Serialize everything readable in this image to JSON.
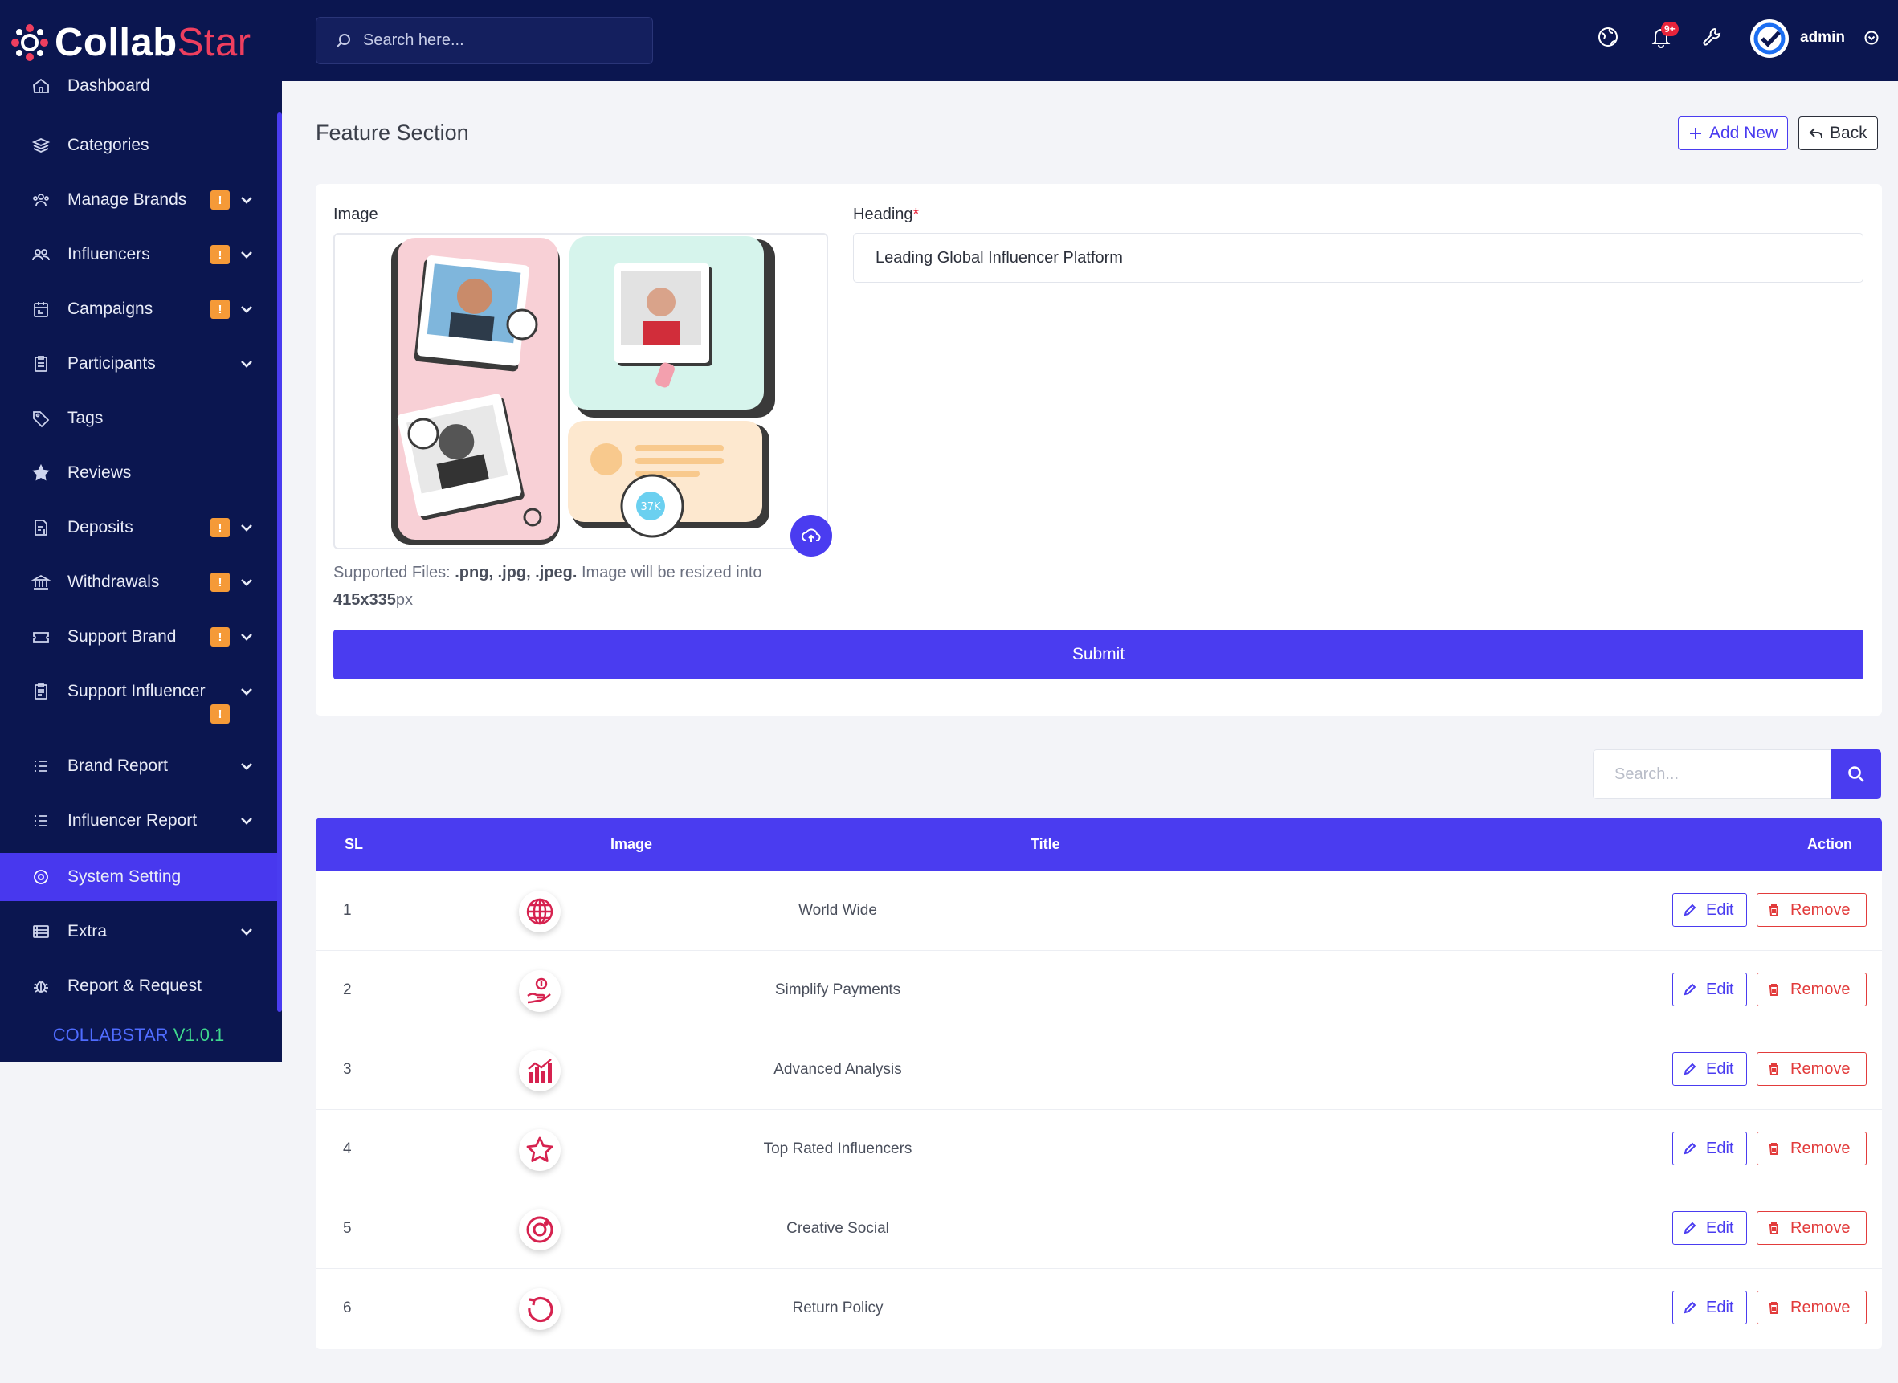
{
  "brand": {
    "name_a": "Collab",
    "name_b": "Star"
  },
  "topbar": {
    "search_placeholder": "Search here...",
    "notifications_badge": "9+",
    "user_name": "admin"
  },
  "sidebar": {
    "items": [
      {
        "label": "Dashboard",
        "icon": "home-icon"
      },
      {
        "label": "Categories",
        "icon": "layers-icon"
      },
      {
        "label": "Manage Brands",
        "icon": "users-group-icon",
        "badge": "!",
        "chevron": true
      },
      {
        "label": "Influencers",
        "icon": "users-icon",
        "badge": "!",
        "chevron": true
      },
      {
        "label": "Campaigns",
        "icon": "calendar-icon",
        "badge": "!",
        "chevron": true
      },
      {
        "label": "Participants",
        "icon": "clipboard-icon",
        "chevron": true
      },
      {
        "label": "Tags",
        "icon": "tag-icon"
      },
      {
        "label": "Reviews",
        "icon": "star-icon"
      },
      {
        "label": "Deposits",
        "icon": "file-dollar-icon",
        "badge": "!",
        "chevron": true
      },
      {
        "label": "Withdrawals",
        "icon": "bank-icon",
        "badge": "!",
        "chevron": true
      },
      {
        "label": "Support Brand",
        "icon": "ticket-icon",
        "badge": "!",
        "chevron": true
      },
      {
        "label": "Support Influencer",
        "icon": "clipboard-list-icon",
        "badge": "!",
        "chevron": true
      },
      {
        "label": "Brand Report",
        "icon": "list-icon",
        "chevron": true
      },
      {
        "label": "Influencer Report",
        "icon": "list-icon",
        "chevron": true
      },
      {
        "label": "System Setting",
        "icon": "settings-icon",
        "active": true
      },
      {
        "label": "Extra",
        "icon": "server-icon",
        "chevron": true
      },
      {
        "label": "Report & Request",
        "icon": "bug-icon"
      }
    ],
    "version_name": "COLLABSTAR",
    "version_number": "V1.0.1"
  },
  "page": {
    "title": "Feature Section",
    "add_new_label": "Add New",
    "back_label": "Back"
  },
  "form": {
    "image_label": "Image",
    "help_prefix": "Supported Files: ",
    "help_types": ".png, .jpg, .jpeg.",
    "help_middle": " Image will be resized into ",
    "help_size": "415x335",
    "help_unit": "px",
    "heading_label": "Heading",
    "heading_required": "*",
    "heading_value": "Leading Global Influencer Platform",
    "submit_label": "Submit",
    "preview_badge": "37K"
  },
  "table": {
    "search_placeholder": "Search...",
    "headers": {
      "sl": "SL",
      "image": "Image",
      "title": "Title",
      "action": "Action"
    },
    "edit_label": "Edit",
    "remove_label": "Remove",
    "rows": [
      {
        "sl": "1",
        "title": "World Wide",
        "icon": "globe-icon"
      },
      {
        "sl": "2",
        "title": "Simplify Payments",
        "icon": "hand-coin-icon"
      },
      {
        "sl": "3",
        "title": "Advanced Analysis",
        "icon": "bar-chart-icon"
      },
      {
        "sl": "4",
        "title": "Top Rated Influencers",
        "icon": "star-icon"
      },
      {
        "sl": "5",
        "title": "Creative Social",
        "icon": "instagram-icon"
      },
      {
        "sl": "6",
        "title": "Return Policy",
        "icon": "refresh-icon"
      }
    ]
  },
  "colors": {
    "navy": "#0b1650",
    "accent": "#4a3cf0",
    "danger": "#e23b3b",
    "badge": "#f59a38",
    "icon_red": "#d6224f"
  }
}
